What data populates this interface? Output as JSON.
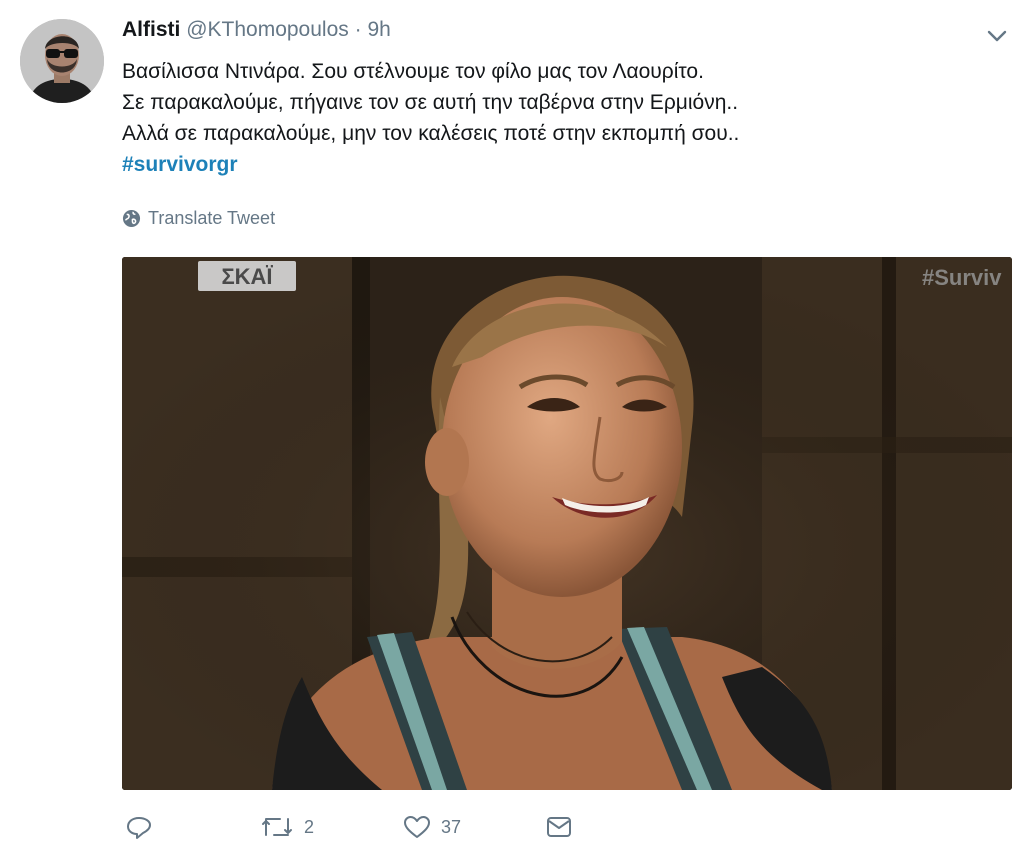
{
  "tweet": {
    "author_name": "Alfisti",
    "author_handle": "@KThomopoulos",
    "separator": "·",
    "time": "9h",
    "lines": [
      "Βασίλισσα Ντινάρα. Σου στέλνουμε τον φίλο μας τον Λαουρίτο.",
      "Σε παρακαλούμε, πήγαινε τον σε αυτή την ταβέρνα στην Ερμιόνη..",
      "Αλλά σε παρακαλούμε, μην τον καλέσεις ποτέ στην εκπομπή σου.."
    ],
    "hashtag": "#survivorgr",
    "translate_label": "Translate Tweet"
  },
  "media": {
    "channel_logo": "ΣΚΑΪ",
    "watermark": "#Surviv"
  },
  "actions": {
    "reply_icon": "reply-icon",
    "retweet_icon": "retweet-icon",
    "retweet_count": "2",
    "like_icon": "heart-icon",
    "like_count": "37",
    "dm_icon": "envelope-icon"
  },
  "colors": {
    "link": "#1d81b8",
    "muted": "#657786",
    "text": "#14171a"
  }
}
